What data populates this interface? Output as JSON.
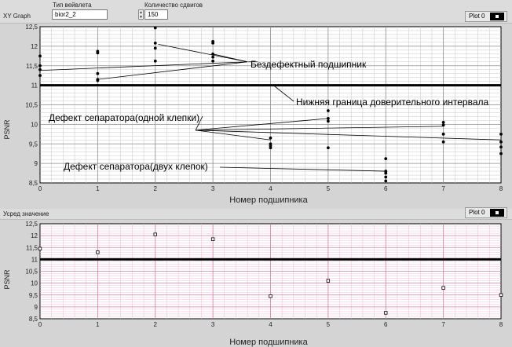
{
  "top_graph": {
    "title": "XY Graph",
    "plot_legend": "Plot 0",
    "xlabel": "Номер подшипника",
    "ylabel": "PSNR",
    "x_ticks": [
      "0",
      "1",
      "2",
      "3",
      "4",
      "5",
      "6",
      "7",
      "8"
    ],
    "y_ticks": [
      "8,5",
      "9",
      "9,5",
      "10",
      "10,5",
      "11",
      "11,5",
      "12",
      "12,5"
    ],
    "annotations": {
      "defect_free": "Бездефектный подшипник",
      "lower_bound": "Нижняя граница доверительного  интервала",
      "separator_one": "Дефект сепаратора(одной клепки)",
      "separator_two": "Дефект сепаратора(двух клепок)"
    }
  },
  "controls": {
    "wavelet_label": "Тип вейвлета",
    "wavelet_value": "bior2_2",
    "shifts_label": "Количество сдвигов",
    "shifts_value": "150"
  },
  "bottom_graph": {
    "title": "Усред значение",
    "plot_legend": "Plot 0",
    "xlabel": "Номер подшипника",
    "ylabel": "PSNR",
    "x_ticks": [
      "0",
      "1",
      "2",
      "3",
      "4",
      "5",
      "6",
      "7",
      "8"
    ],
    "y_ticks": [
      "8,5",
      "9",
      "9,5",
      "10",
      "10,5",
      "11",
      "11,5",
      "12",
      "12,5"
    ]
  },
  "chart_data": [
    {
      "type": "scatter",
      "xlabel": "Номер подшипника",
      "ylabel": "PSNR",
      "xlim": [
        0,
        8
      ],
      "ylim": [
        8.5,
        12.5
      ],
      "grid": true,
      "threshold": 11.0,
      "points": [
        {
          "x": 0,
          "y": 11.75
        },
        {
          "x": 0,
          "y": 11.5
        },
        {
          "x": 0,
          "y": 11.4
        },
        {
          "x": 0,
          "y": 11.25
        },
        {
          "x": 1,
          "y": 11.87
        },
        {
          "x": 1,
          "y": 11.83
        },
        {
          "x": 1,
          "y": 11.3
        },
        {
          "x": 1,
          "y": 11.15
        },
        {
          "x": 1,
          "y": 11.12
        },
        {
          "x": 2,
          "y": 12.47
        },
        {
          "x": 2,
          "y": 12.08
        },
        {
          "x": 2,
          "y": 11.95
        },
        {
          "x": 2,
          "y": 11.62
        },
        {
          "x": 3,
          "y": 12.12
        },
        {
          "x": 3,
          "y": 12.08
        },
        {
          "x": 3,
          "y": 11.8
        },
        {
          "x": 3,
          "y": 11.72
        },
        {
          "x": 3,
          "y": 11.62
        },
        {
          "x": 4,
          "y": 9.65
        },
        {
          "x": 4,
          "y": 9.5
        },
        {
          "x": 4,
          "y": 9.45
        },
        {
          "x": 4,
          "y": 9.4
        },
        {
          "x": 5,
          "y": 10.35
        },
        {
          "x": 5,
          "y": 10.15
        },
        {
          "x": 5,
          "y": 10.08
        },
        {
          "x": 5,
          "y": 9.4
        },
        {
          "x": 6,
          "y": 9.12
        },
        {
          "x": 6,
          "y": 8.8
        },
        {
          "x": 6,
          "y": 8.75
        },
        {
          "x": 6,
          "y": 8.65
        },
        {
          "x": 6,
          "y": 8.55
        },
        {
          "x": 7,
          "y": 10.05
        },
        {
          "x": 7,
          "y": 9.98
        },
        {
          "x": 7,
          "y": 9.75
        },
        {
          "x": 7,
          "y": 9.55
        },
        {
          "x": 8,
          "y": 9.75
        },
        {
          "x": 8,
          "y": 9.55
        },
        {
          "x": 8,
          "y": 9.42
        },
        {
          "x": 8,
          "y": 9.25
        }
      ]
    },
    {
      "type": "scatter",
      "xlabel": "Номер подшипника",
      "ylabel": "PSNR",
      "xlim": [
        0,
        8
      ],
      "ylim": [
        8.5,
        12.5
      ],
      "grid": true,
      "threshold": 11.0,
      "points": [
        {
          "x": 0,
          "y": 11.45
        },
        {
          "x": 1,
          "y": 11.3
        },
        {
          "x": 2,
          "y": 12.05
        },
        {
          "x": 3,
          "y": 11.85
        },
        {
          "x": 4,
          "y": 9.45
        },
        {
          "x": 5,
          "y": 10.1
        },
        {
          "x": 6,
          "y": 8.75
        },
        {
          "x": 7,
          "y": 9.8
        },
        {
          "x": 8,
          "y": 9.5
        }
      ]
    }
  ]
}
